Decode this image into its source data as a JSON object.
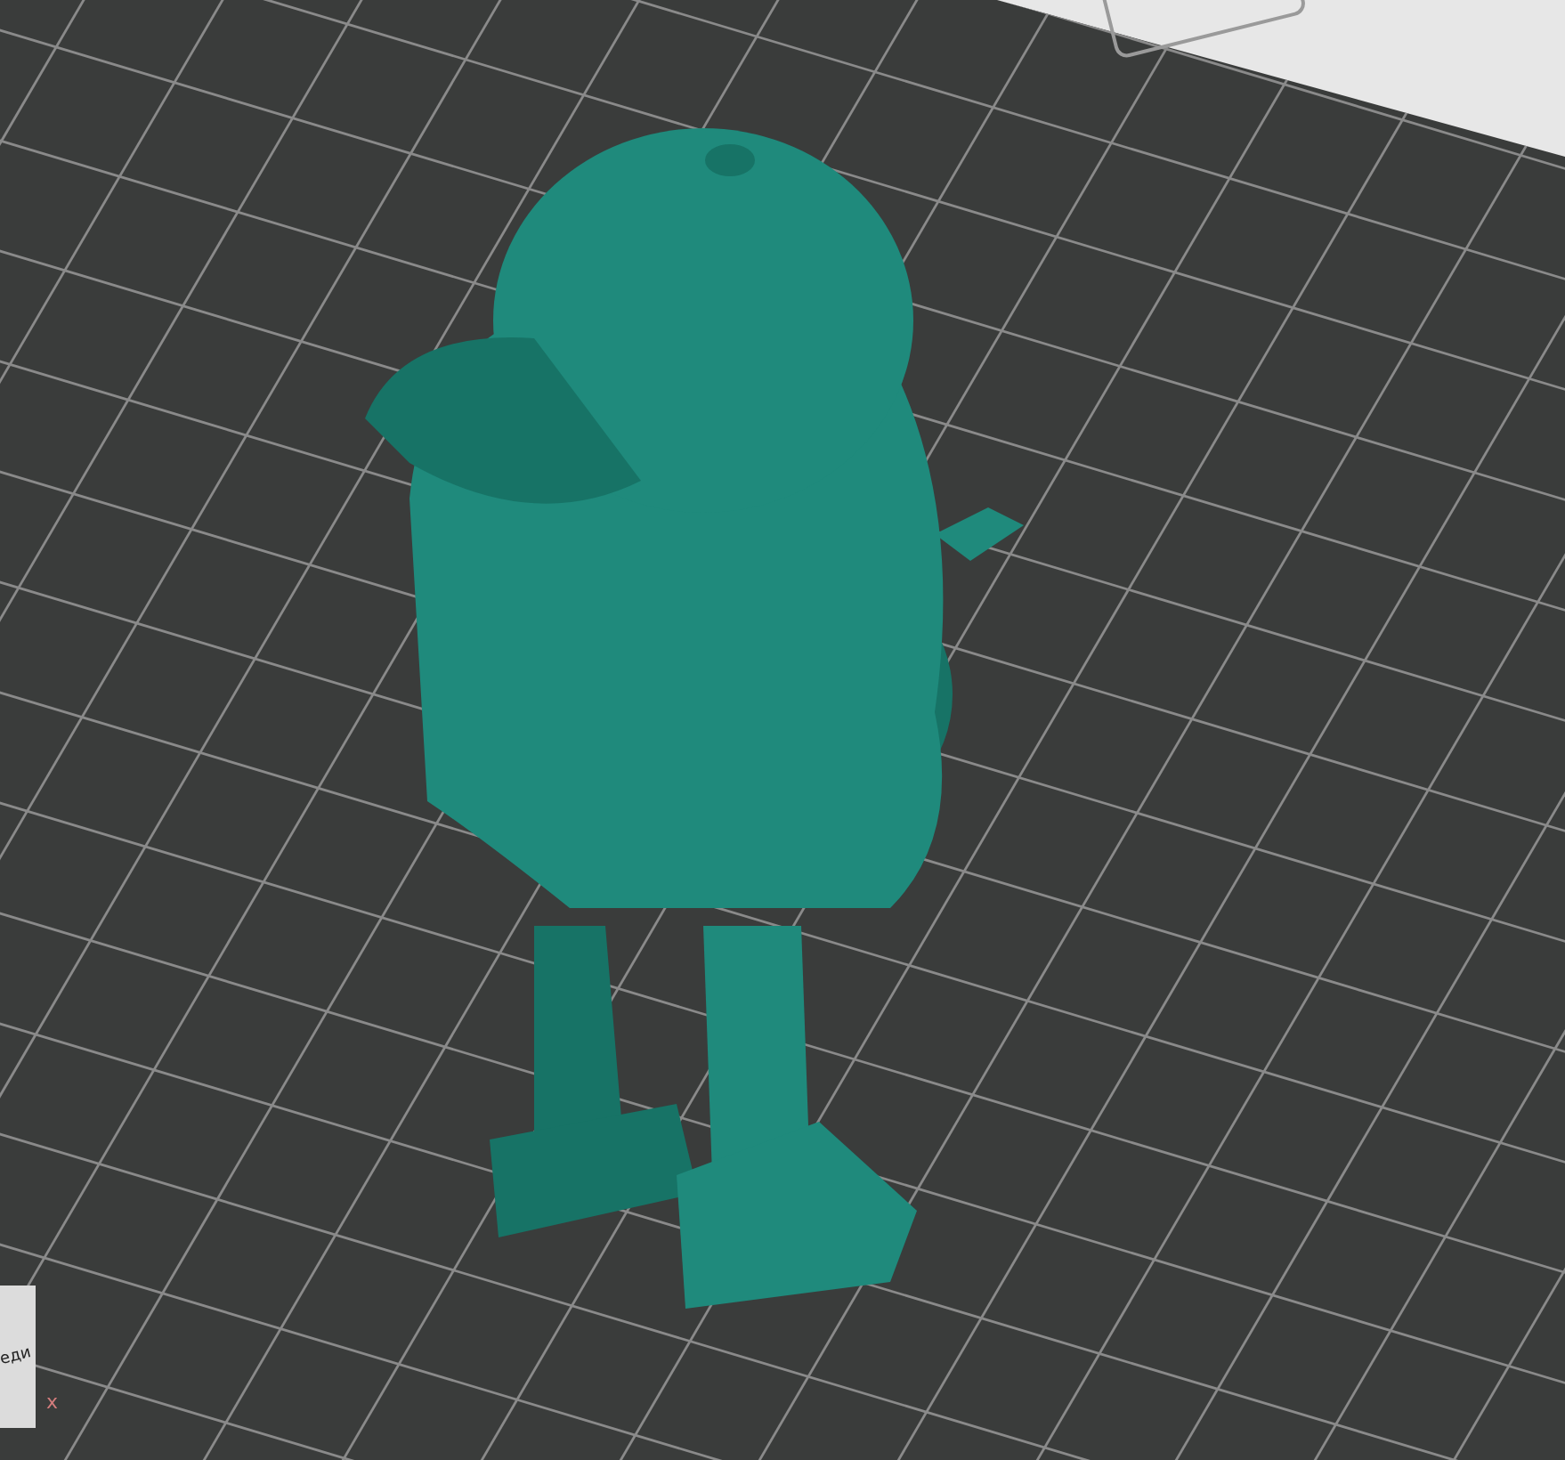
{
  "viewport": {
    "view_cube": {
      "face_label": "еди"
    },
    "axis": {
      "label": "x"
    }
  }
}
